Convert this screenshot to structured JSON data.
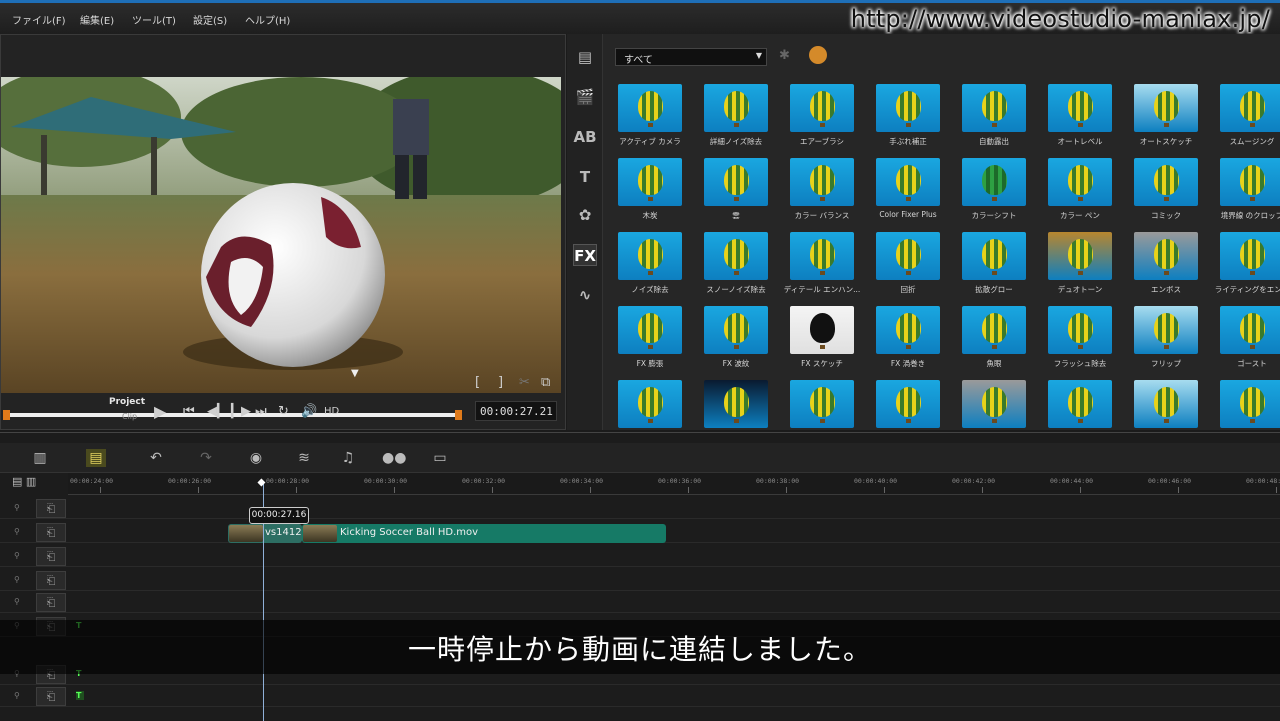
{
  "menubar": {
    "items": [
      "ファイル(F)",
      "編集(E)",
      "ツール(T)",
      "設定(S)",
      "ヘルプ(H)"
    ],
    "watermark": "http://www.videostudio-maniax.jp/"
  },
  "preview": {
    "mode_project": "Project",
    "mode_clip": "Clip",
    "hd_label": "HD",
    "timecode": "00:00:27.21"
  },
  "library": {
    "filter_value": "すべて",
    "items": [
      "アクティブ カメラ",
      "詳細ノイズ除去",
      "エアーブラシ",
      "手ぶれ補正",
      "自動露出",
      "オートレベル",
      "オートスケッチ",
      "スムージング",
      "木炭",
      "雲",
      "カラー バランス",
      "Color Fixer Plus",
      "カラーシフト",
      "カラー ペン",
      "コミック",
      "境界線 のクロップ",
      "ノイズ除去",
      "スノーノイズ除去",
      "ディテール エンハン...",
      "回折",
      "拡散グロー",
      "デュオトーン",
      "エンボス",
      "ライティングをエンハ",
      "FX 膨張",
      "FX 波紋",
      "FX スケッチ",
      "FX 渦巻き",
      "魚眼",
      "フラッシュ除去",
      "フリップ",
      "ゴースト",
      "",
      "",
      "",
      "",
      "",
      "",
      "",
      ""
    ]
  },
  "timeline": {
    "ruler": [
      "00:00:24:00",
      "00:00:26:00",
      "00:00:28:00",
      "00:00:30:00",
      "00:00:32:00",
      "00:00:34:00",
      "00:00:36:00",
      "00:00:38:00",
      "00:00:40:00",
      "00:00:42:00",
      "00:00:44:00",
      "00:00:46:00",
      "00:00:48:0"
    ],
    "tooltip": "00:00:27.16",
    "transition_clip": "vs1412",
    "main_clip": "Kicking Soccer Ball HD.mov"
  },
  "subtitle": "一時停止から動画に連結しました。",
  "colors": {
    "accent": "#1e6fb8",
    "clip": "#167a66",
    "thumb_bg": "#1aa7e0"
  }
}
